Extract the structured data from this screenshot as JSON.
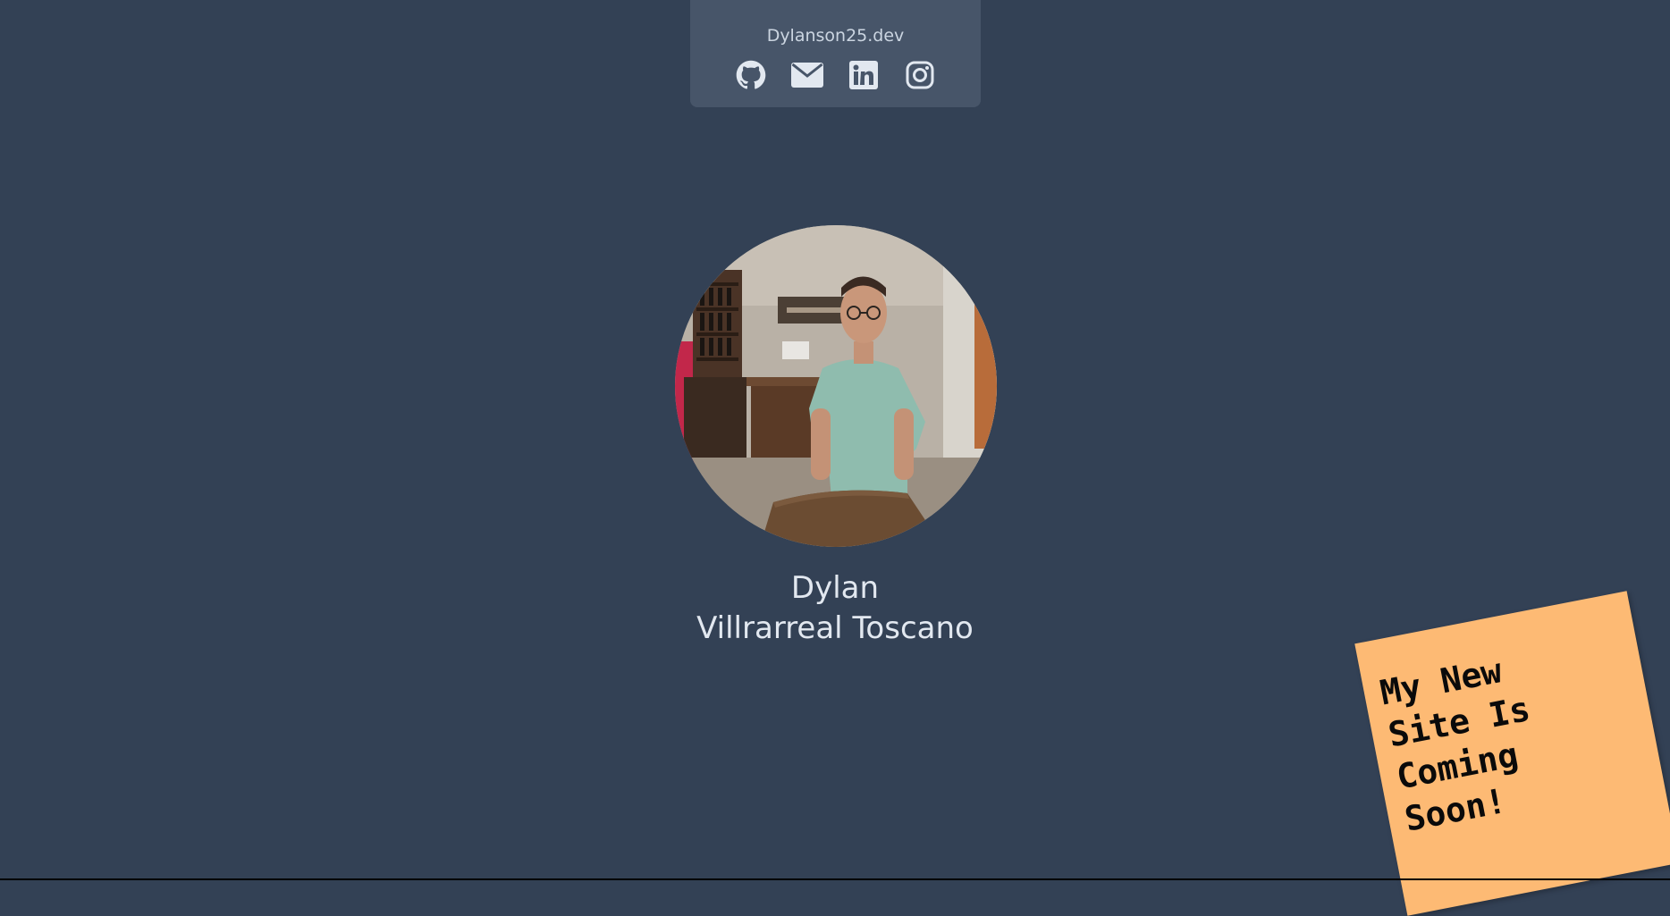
{
  "header": {
    "site_name": "Dylanson25.dev",
    "links": [
      {
        "name": "github",
        "icon": "github-icon"
      },
      {
        "name": "email",
        "icon": "envelope-icon"
      },
      {
        "name": "linkedin",
        "icon": "linkedin-icon"
      },
      {
        "name": "instagram",
        "icon": "instagram-icon"
      }
    ]
  },
  "profile": {
    "first_name": "Dylan",
    "last_name": "Villrarreal Toscano"
  },
  "sticky_note": {
    "lines": [
      "My New",
      "Site Is",
      "Coming",
      "Soon!"
    ]
  },
  "colors": {
    "background": "#334155",
    "card": "#475569",
    "text": "#e2e8f0",
    "sticky_note": "#fdba74"
  }
}
